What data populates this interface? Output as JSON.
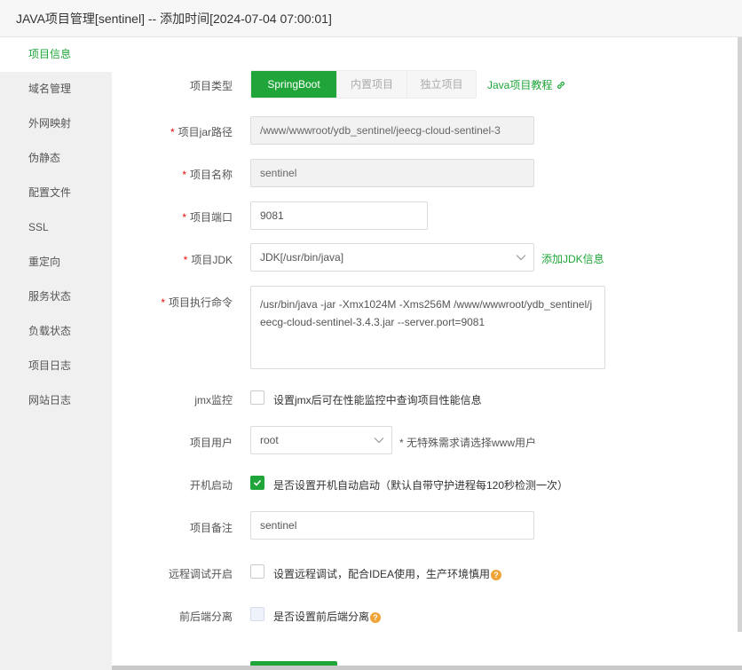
{
  "window": {
    "title": "JAVA项目管理[sentinel] -- 添加时间[2024-07-04 07:00:01]"
  },
  "sidebar": {
    "items": [
      {
        "label": "项目信息"
      },
      {
        "label": "域名管理"
      },
      {
        "label": "外网映射"
      },
      {
        "label": "伪静态"
      },
      {
        "label": "配置文件"
      },
      {
        "label": "SSL"
      },
      {
        "label": "重定向"
      },
      {
        "label": "服务状态"
      },
      {
        "label": "负载状态"
      },
      {
        "label": "项目日志"
      },
      {
        "label": "网站日志"
      }
    ]
  },
  "form": {
    "type": {
      "label": "项目类型",
      "options": [
        "SpringBoot",
        "内置项目",
        "独立项目"
      ],
      "tutorial": "Java项目教程"
    },
    "jar_path": {
      "label": "项目jar路径",
      "value": "/www/wwwroot/ydb_sentinel/jeecg-cloud-sentinel-3"
    },
    "name": {
      "label": "项目名称",
      "value": "sentinel"
    },
    "port": {
      "label": "项目端口",
      "value": "9081"
    },
    "jdk": {
      "label": "项目JDK",
      "value": "JDK[/usr/bin/java]",
      "add_link": "添加JDK信息"
    },
    "command": {
      "label": "项目执行命令",
      "value": "/usr/bin/java  -jar -Xmx1024M -Xms256M  /www/wwwroot/ydb_sentinel/jeecg-cloud-sentinel-3.4.3.jar --server.port=9081"
    },
    "jmx": {
      "label": "jmx监控",
      "text": "设置jmx后可在性能监控中查询项目性能信息"
    },
    "user": {
      "label": "项目用户",
      "value": "root",
      "hint": "* 无特殊需求请选择www用户"
    },
    "autostart": {
      "label": "开机启动",
      "text": "是否设置开机自动启动（默认自带守护进程每120秒检测一次）"
    },
    "remark": {
      "label": "项目备注",
      "value": "sentinel"
    },
    "remote_debug": {
      "label": "远程调试开启",
      "text": "设置远程调试，配合IDEA使用，生产环境慎用"
    },
    "separation": {
      "label": "前后端分离",
      "text": "是否设置前后端分离"
    }
  },
  "colors": {
    "accent": "#20a53a",
    "required": "#ef0808",
    "help": "#f0a336"
  }
}
